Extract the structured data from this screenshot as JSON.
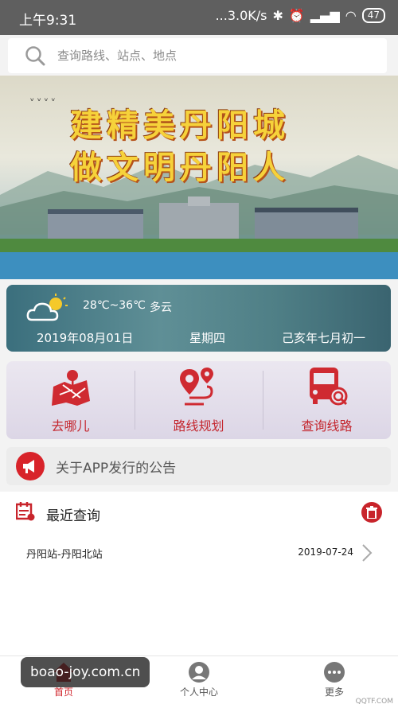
{
  "status_bar": {
    "time": "上午9:31",
    "speed": "...3.0K/s",
    "battery": "47"
  },
  "search": {
    "placeholder": "查询路线、站点、地点"
  },
  "banner": {
    "line1": "建精美丹阳城",
    "line2": "做文明丹阳人"
  },
  "weather": {
    "temp": "28℃~36℃",
    "condition": "多云",
    "date": "2019年08月01日",
    "weekday": "星期四",
    "lunar": "己亥年七月初一"
  },
  "quick_actions": [
    {
      "label": "去哪儿",
      "icon": "map-pin-icon"
    },
    {
      "label": "路线规划",
      "icon": "route-icon"
    },
    {
      "label": "查询线路",
      "icon": "bus-search-icon"
    }
  ],
  "notice": {
    "text": "关于APP发行的公告"
  },
  "recent": {
    "title": "最近查询",
    "items": [
      {
        "route": "丹阳站-丹阳北站",
        "date": "2019-07-24"
      }
    ]
  },
  "bottom_nav": [
    {
      "label": "首页",
      "icon": "home-icon"
    },
    {
      "label": "个人中心",
      "icon": "user-icon"
    },
    {
      "label": "更多",
      "icon": "more-icon"
    }
  ],
  "watermark": "boao-joy.com.cn",
  "corner_text": "QQTF.COM",
  "colors": {
    "accent": "#d0252c",
    "status_bar": "#5f5f5f",
    "weather_bg": "#4f7f86"
  }
}
